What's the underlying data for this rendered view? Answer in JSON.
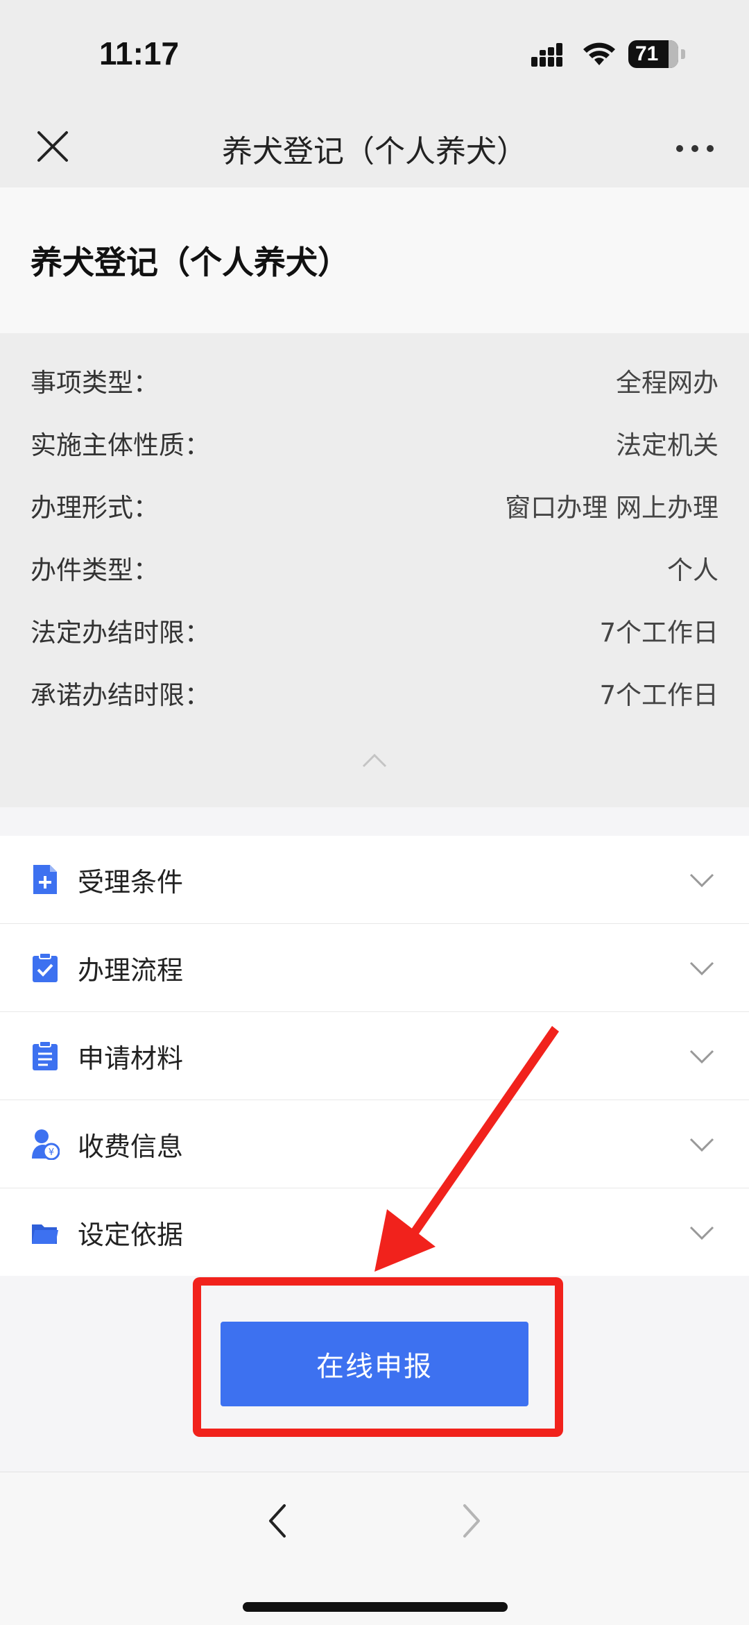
{
  "status_bar": {
    "time": "11:17",
    "battery": "71"
  },
  "nav": {
    "title": "养犬登记（个人养犬）",
    "close_icon": "close-icon",
    "more_icon": "more-dots-icon"
  },
  "page": {
    "title": "养犬登记（个人养犬）"
  },
  "info": [
    {
      "label": "事项类型：",
      "value": "全程网办"
    },
    {
      "label": "实施主体性质：",
      "value": "法定机关"
    },
    {
      "label": "办理形式：",
      "value": "窗口办理 网上办理"
    },
    {
      "label": "办件类型：",
      "value": "个人"
    },
    {
      "label": "法定办结时限：",
      "value": "7个工作日"
    },
    {
      "label": "承诺办结时限：",
      "value": "7个工作日"
    }
  ],
  "sections": [
    {
      "label": "受理条件",
      "icon": "doc-plus-icon"
    },
    {
      "label": "办理流程",
      "icon": "clipboard-check-icon"
    },
    {
      "label": "申请材料",
      "icon": "clipboard-list-icon"
    },
    {
      "label": "收费信息",
      "icon": "user-yen-icon"
    },
    {
      "label": "设定依据",
      "icon": "folder-icon"
    }
  ],
  "action": {
    "submit_label": "在线申报"
  },
  "colors": {
    "accent": "#3d71f0",
    "highlight": "#f1221c"
  }
}
